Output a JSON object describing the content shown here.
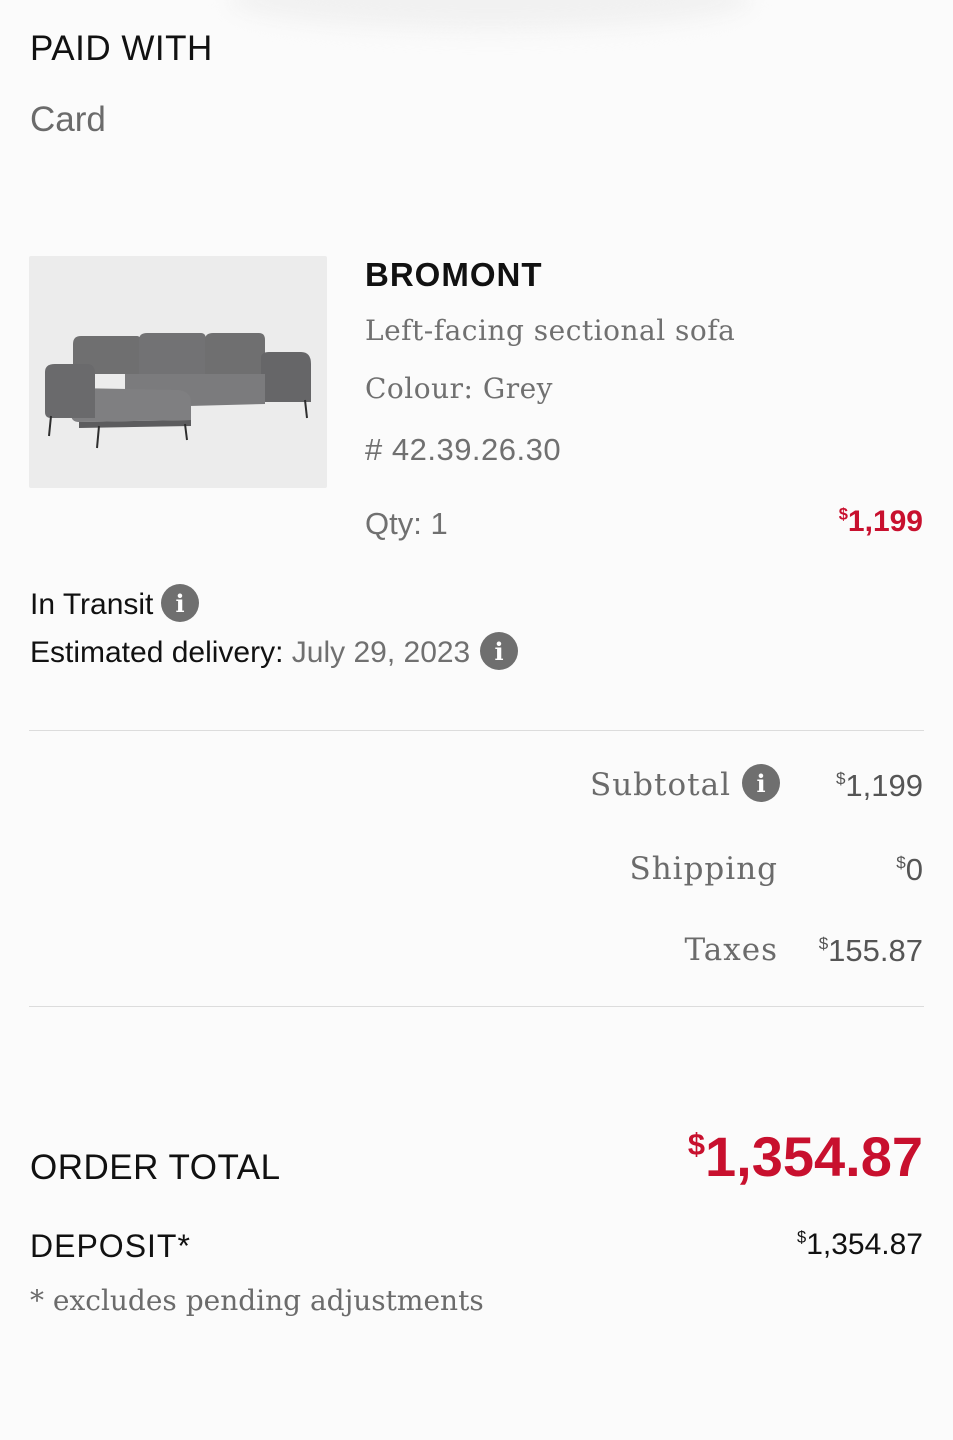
{
  "payment": {
    "title": "PAID WITH",
    "method": "Card"
  },
  "item": {
    "name": "BROMONT",
    "description": "Left-facing sectional sofa",
    "colour": "Colour: Grey",
    "sku": "# 42.39.26.30",
    "qty": "Qty: 1",
    "price_symbol": "$",
    "price": "1,199",
    "image_icon": "sofa-image"
  },
  "delivery": {
    "status": "In Transit",
    "eta_label": "Estimated delivery:",
    "eta_date": "July 29, 2023"
  },
  "summary": {
    "subtotal_label": "Subtotal",
    "subtotal_symbol": "$",
    "subtotal": "1,199",
    "shipping_label": "Shipping",
    "shipping_symbol": "$",
    "shipping": "0",
    "taxes_label": "Taxes",
    "taxes_symbol": "$",
    "taxes": "155.87"
  },
  "total": {
    "label": "ORDER TOTAL",
    "symbol": "$",
    "value": "1,354.87",
    "deposit_label": "DEPOSIT*",
    "deposit_symbol": "$",
    "deposit_value": "1,354.87",
    "note": "* excludes pending adjustments"
  },
  "colors": {
    "accent_red": "#c8102e",
    "info_icon": "#6f6f6f"
  }
}
